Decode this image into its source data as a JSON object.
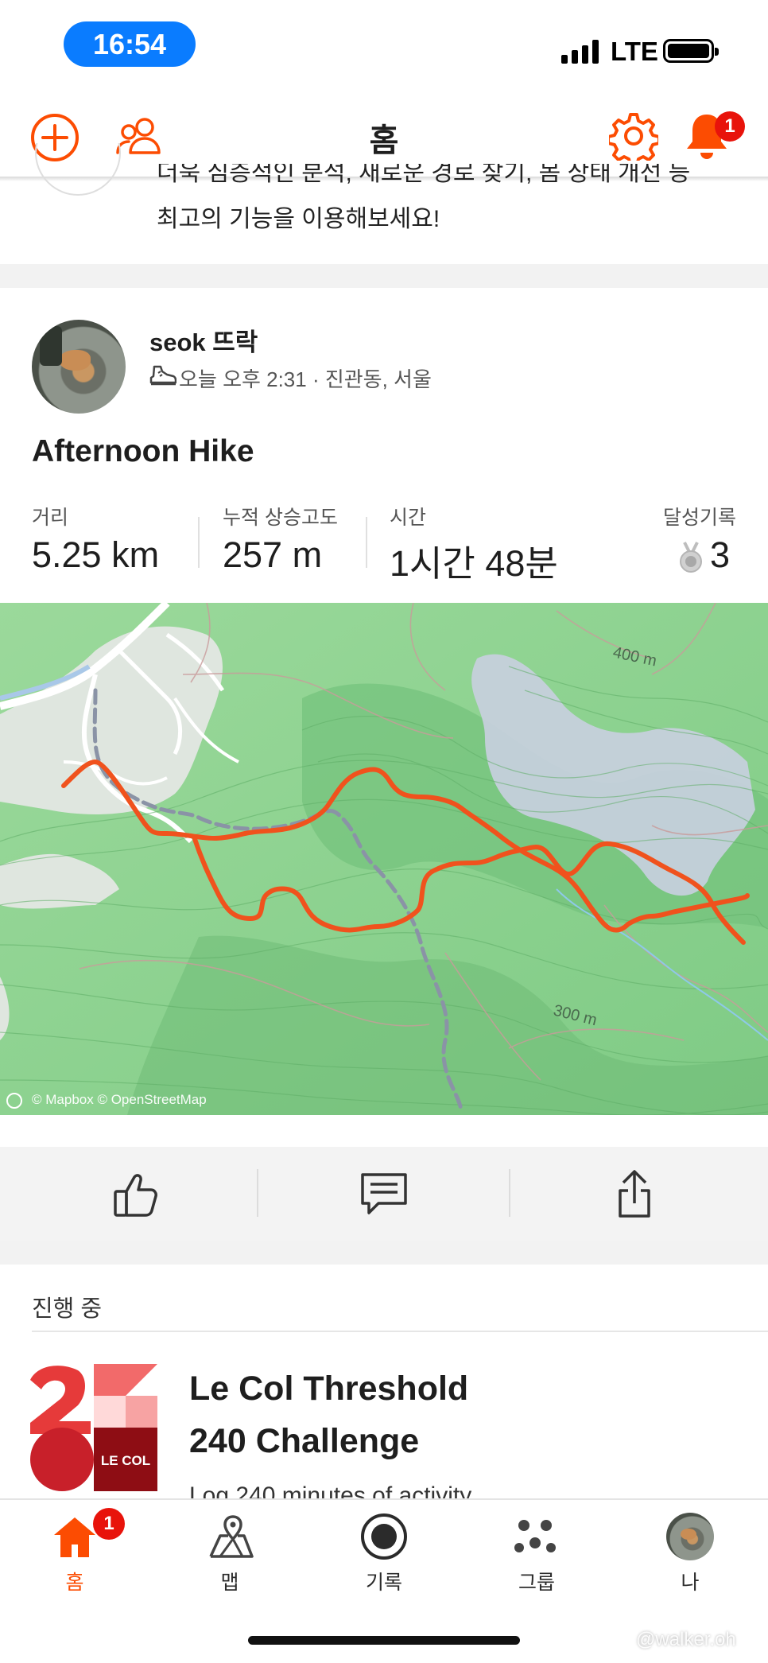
{
  "status_bar": {
    "time": "16:54",
    "network": "LTE"
  },
  "header": {
    "title": "홈",
    "notification_count": "1"
  },
  "promo": {
    "line1": "더욱 심층적인 분석, 새로운 경로 찾기, 몸 상태 개선 등",
    "line2": "최고의 기능을 이용해보세요!"
  },
  "activity": {
    "athlete": "seok 뜨락",
    "meta": "오늘 오후 2:31 · 진관동, 서울",
    "title": "Afternoon Hike",
    "stats": [
      {
        "label": "거리",
        "value": "5.25 km"
      },
      {
        "label": "누적 상승고도",
        "value": "257 m"
      },
      {
        "label": "시간",
        "value": "1시간 48분"
      },
      {
        "label": "달성기록",
        "value": "3"
      }
    ],
    "map": {
      "contour_top": "400 m",
      "contour_bottom": "300 m",
      "attribution": "© Mapbox © OpenStreetMap",
      "route_color": "#f0521d"
    }
  },
  "in_progress": {
    "section_label": "진행 중",
    "challenge_title_line1": "Le Col Threshold",
    "challenge_title_line2": "240 Challenge",
    "challenge_subtitle": "Log 240 minutes of activity",
    "logo_text": "LE COL"
  },
  "tabbar": {
    "items": [
      {
        "label": "홈",
        "icon": "home-icon",
        "active": true,
        "badge": "1"
      },
      {
        "label": "맵",
        "icon": "map-icon",
        "active": false
      },
      {
        "label": "기록",
        "icon": "record-icon",
        "active": false
      },
      {
        "label": "그룹",
        "icon": "groups-icon",
        "active": false
      },
      {
        "label": "나",
        "icon": "profile-icon",
        "active": false
      }
    ]
  },
  "watermark": "@walker.oh",
  "colors": {
    "accent": "#fc4c02",
    "badge": "#e8130b",
    "status_pill": "#0a7cff"
  }
}
